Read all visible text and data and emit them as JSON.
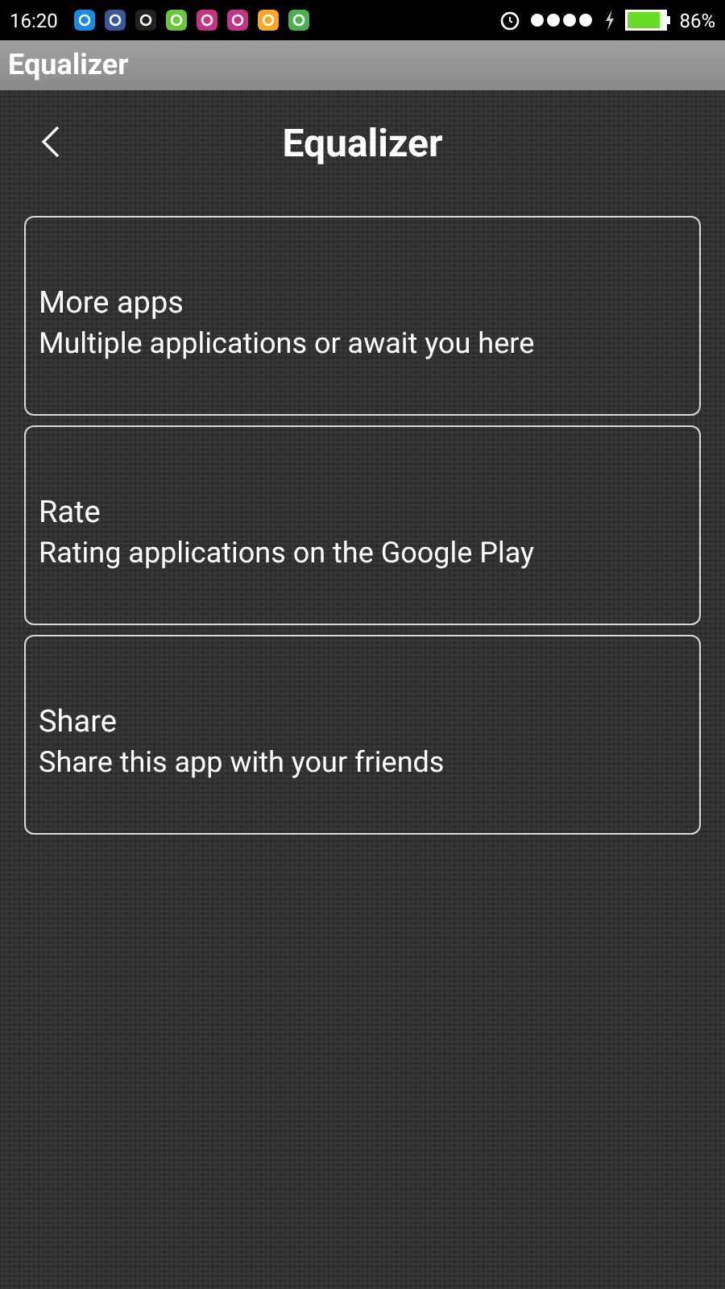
{
  "status_bar": {
    "time": "16:20",
    "battery": "86%"
  },
  "action_bar": {
    "title": "Equalizer"
  },
  "header": {
    "title": "Equalizer"
  },
  "items": [
    {
      "title": "More apps",
      "subtitle": "Multiple applications or await you here"
    },
    {
      "title": "Rate",
      "subtitle": "Rating applications on the Google Play"
    },
    {
      "title": "Share",
      "subtitle": "Share this app with your friends"
    }
  ]
}
